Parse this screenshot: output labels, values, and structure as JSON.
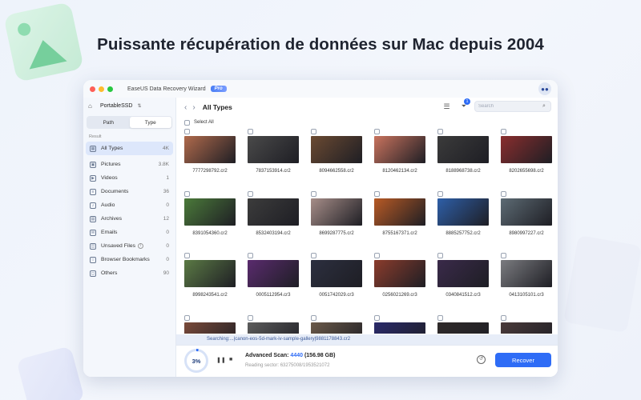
{
  "headline": "Puissante récupération de données sur Mac depuis 2004",
  "window": {
    "title": "EaseUS Data Recovery Wizard",
    "badge": "Pro"
  },
  "sidebar": {
    "drive": "PortableSSD",
    "tabs": [
      "Path",
      "Type"
    ],
    "active_tab": "Type",
    "result_label": "Result",
    "categories": [
      {
        "label": "All Types",
        "count": "4K",
        "icon": "grid-icon"
      },
      {
        "label": "Pictures",
        "count": "3.8K",
        "icon": "picture-icon"
      },
      {
        "label": "Videos",
        "count": "1",
        "icon": "video-icon"
      },
      {
        "label": "Documents",
        "count": "36",
        "icon": "document-icon"
      },
      {
        "label": "Audio",
        "count": "0",
        "icon": "audio-icon"
      },
      {
        "label": "Archives",
        "count": "12",
        "icon": "archive-icon"
      },
      {
        "label": "Emails",
        "count": "0",
        "icon": "email-icon"
      },
      {
        "label": "Unsaved Files",
        "count": "0",
        "icon": "unsaved-icon"
      },
      {
        "label": "Browser Bookmarks",
        "count": "0",
        "icon": "bookmark-icon"
      },
      {
        "label": "Others",
        "count": "90",
        "icon": "others-icon"
      }
    ]
  },
  "toolbar": {
    "location_title": "All Types",
    "filter_badge": "1",
    "search_placeholder": "Search",
    "select_all": "Select All"
  },
  "files": [
    {
      "name": "7777298792.cr2",
      "color": "#b06a4c"
    },
    {
      "name": "7837153914.cr2",
      "color": "#4a4a4a"
    },
    {
      "name": "8094662558.cr2",
      "color": "#6b4a32"
    },
    {
      "name": "8120462134.cr2",
      "color": "#c9735e"
    },
    {
      "name": "8188968738.cr2",
      "color": "#3b3b3b"
    },
    {
      "name": "8202655698.cr2",
      "color": "#8a2e2e"
    },
    {
      "name": "8391054360.cr2",
      "color": "#4b7a3a"
    },
    {
      "name": "8532403194.cr2",
      "color": "#3c3c3c"
    },
    {
      "name": "8699287775.cr2",
      "color": "#a68d88"
    },
    {
      "name": "8755167371.cr2",
      "color": "#b85a25"
    },
    {
      "name": "8885257752.cr2",
      "color": "#2e5fa8"
    },
    {
      "name": "8980997227.cr2",
      "color": "#5d6b74"
    },
    {
      "name": "8998243541.cr2",
      "color": "#5b7a45"
    },
    {
      "name": "0005112954.cr3",
      "color": "#5a2b6e"
    },
    {
      "name": "0051742029.cr3",
      "color": "#2c2f3f"
    },
    {
      "name": "0256021269.cr3",
      "color": "#8b3c2c"
    },
    {
      "name": "0340841512.cr3",
      "color": "#3a2a4a"
    },
    {
      "name": "0413105101.cr3",
      "color": "#7b7c80"
    },
    {
      "name": "",
      "color": "#7a4a3a"
    },
    {
      "name": "",
      "color": "#5c5c5c"
    },
    {
      "name": "",
      "color": "#6b5a4a"
    },
    {
      "name": "",
      "color": "#2a2a6a"
    },
    {
      "name": "",
      "color": "#2f2a2a"
    },
    {
      "name": "",
      "color": "#4a3a3a"
    }
  ],
  "status": {
    "path": "Searching:...|canon-eos-5d-mark-iv-sample-gallery|9881178843.cr2",
    "progress": "3%",
    "progress_value": 0.03,
    "scan_label": "Advanced Scan:",
    "scan_count": "4440",
    "scan_size": "(156.98 GB)",
    "sector": "Reading sector: 63275008/1953521072",
    "recover": "Recover"
  }
}
